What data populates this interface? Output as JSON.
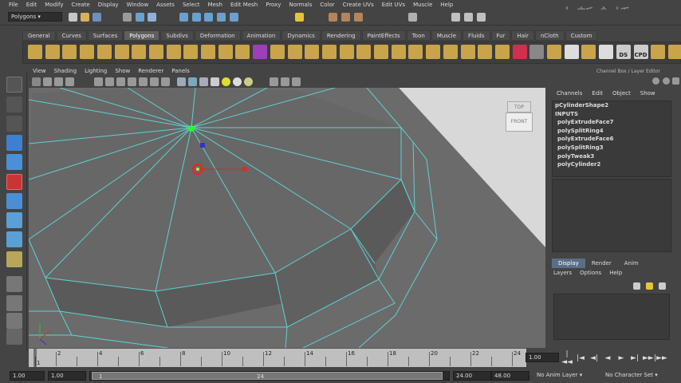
{
  "menubar": [
    "File",
    "Edit",
    "Modify",
    "Create",
    "Display",
    "Window",
    "Assets",
    "Select",
    "Mesh",
    "Edit Mesh",
    "Proxy",
    "Normals",
    "Color",
    "Create UVs",
    "Edit UVs",
    "Muscle",
    "Help"
  ],
  "watermark": "中新金桥",
  "status_line": {
    "menu_set": "Polygons"
  },
  "shelf_tabs": [
    "General",
    "Curves",
    "Surfaces",
    "Polygons",
    "Subdivs",
    "Deformation",
    "Animation",
    "Dynamics",
    "Rendering",
    "PaintEffects",
    "Toon",
    "Muscle",
    "Fluids",
    "Fur",
    "Hair",
    "nCloth",
    "Custom"
  ],
  "shelf_active_tab": "Polygons",
  "shelf_icon_labels": {
    "ds": "DS",
    "cpd": "CPD"
  },
  "panel_menu": [
    "View",
    "Shading",
    "Lighting",
    "Show",
    "Renderer",
    "Panels"
  ],
  "viewcube": {
    "top": "TOP",
    "front": "FRONT"
  },
  "channel_box": {
    "title": "Channel Box / Layer Editor",
    "menu": [
      "Channels",
      "Edit",
      "Object",
      "Show"
    ],
    "object": "pCylinderShape2",
    "inputs_label": "INPUTS",
    "inputs": [
      "polyExtrudeFace7",
      "polySplitRing4",
      "polyExtrudeFace6",
      "polySplitRing3",
      "polyTweak3",
      "polyCylinder2"
    ]
  },
  "layer_editor": {
    "tabs": [
      "Display",
      "Render",
      "Anim"
    ],
    "active_tab": "Display",
    "menu": [
      "Layers",
      "Options",
      "Help"
    ]
  },
  "time_slider": {
    "ticks": [
      "2",
      "4",
      "6",
      "8",
      "10",
      "12",
      "14",
      "16",
      "18",
      "20",
      "22",
      "24"
    ],
    "start_label": "1",
    "current_frame": "1.00"
  },
  "range_slider": {
    "start_time": "1.00",
    "playback_start": "1.00",
    "range_start_label": "1",
    "range_end_label": "24",
    "playback_end": "24.00",
    "end_time": "48.00",
    "anim_layer": "No Anim Layer",
    "character_set": "No Character Set"
  },
  "playback_controls": [
    "|◄◄",
    "|◄",
    "◄|",
    "◄",
    "►",
    "►|",
    "►►|",
    "►►"
  ],
  "colors": {
    "wire": "#5fd0d0",
    "viewport_bg": "#6b6b6b",
    "selected_vertex": "#2f2",
    "active_tab": "#5a6e86"
  }
}
